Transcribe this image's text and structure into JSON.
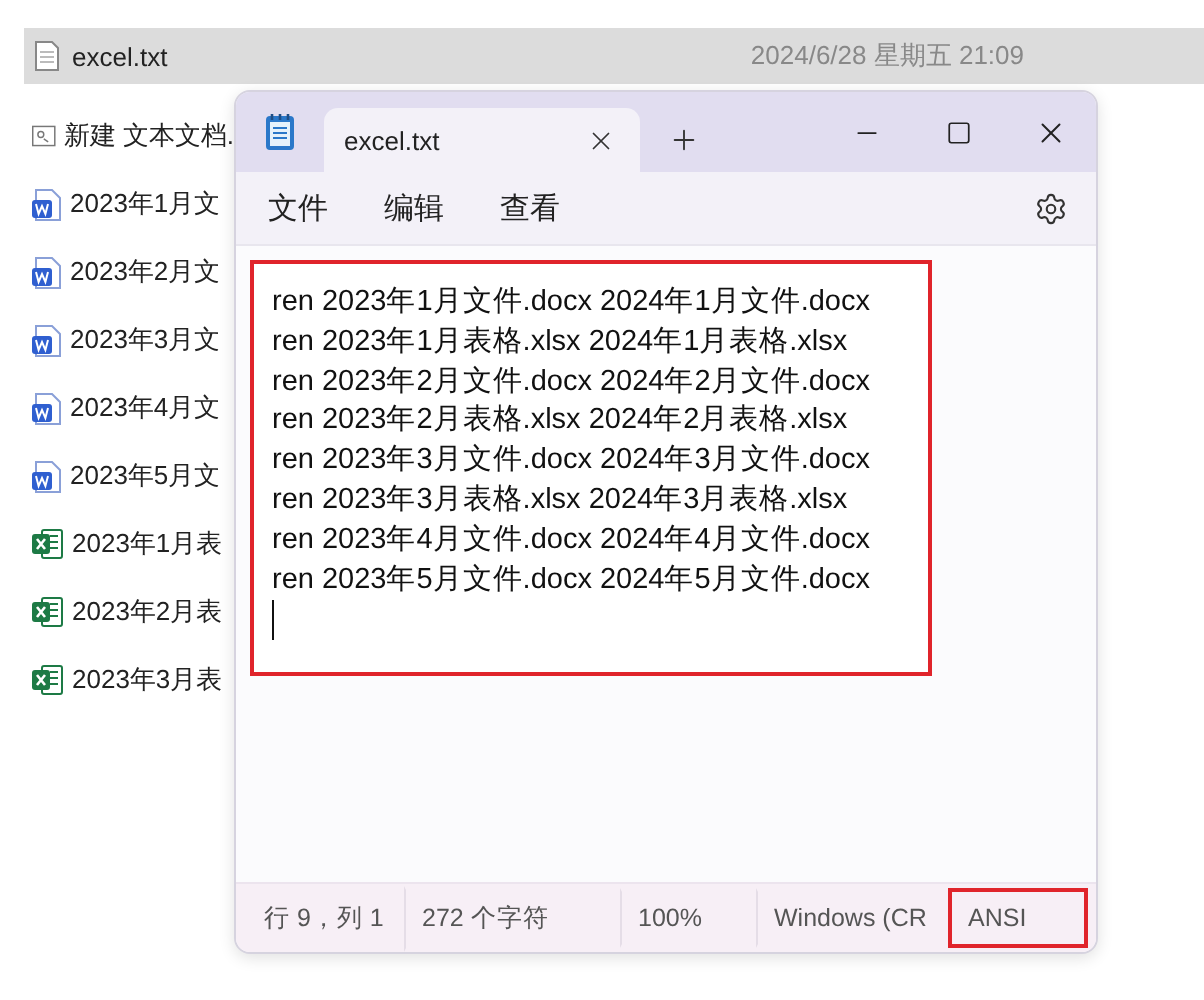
{
  "file_list": {
    "items": [
      {
        "name": "excel.txt",
        "date": "2024/6/28 星期五 21:09",
        "kind": "text",
        "selected": true
      },
      {
        "name": "新建 文本文档.",
        "kind": "shortcut",
        "selected": false
      },
      {
        "name": "2023年1月文",
        "kind": "word",
        "selected": false
      },
      {
        "name": "2023年2月文",
        "kind": "word",
        "selected": false
      },
      {
        "name": "2023年3月文",
        "kind": "word",
        "selected": false
      },
      {
        "name": "2023年4月文",
        "kind": "word",
        "selected": false
      },
      {
        "name": "2023年5月文",
        "kind": "word",
        "selected": false
      },
      {
        "name": "2023年1月表",
        "kind": "excel",
        "selected": false
      },
      {
        "name": "2023年2月表",
        "kind": "excel",
        "selected": false
      },
      {
        "name": "2023年3月表",
        "kind": "excel",
        "selected": false
      }
    ]
  },
  "notepad": {
    "tabs": [
      {
        "title": "excel.txt",
        "selected": true
      }
    ],
    "menu": [
      "文件",
      "编辑",
      "查看"
    ],
    "editor": {
      "highlighted": true,
      "lines": [
        "ren 2023年1月文件.docx 2024年1月文件.docx",
        "ren 2023年1月表格.xlsx 2024年1月表格.xlsx",
        "ren 2023年2月文件.docx 2024年2月文件.docx",
        "ren 2023年2月表格.xlsx 2024年2月表格.xlsx",
        "ren 2023年3月文件.docx 2024年3月文件.docx",
        "ren 2023年3月表格.xlsx 2024年3月表格.xlsx",
        "ren 2023年4月文件.docx 2024年4月文件.docx",
        "ren 2023年5月文件.docx 2024年5月文件.docx"
      ]
    },
    "status_bar": [
      {
        "text": "行 9，列 1",
        "highlighted": false
      },
      {
        "text": "272 个字符",
        "highlighted": false
      },
      {
        "text": "100%",
        "highlighted": false
      },
      {
        "text": "Windows (CR",
        "highlighted": false
      },
      {
        "text": "ANSI",
        "highlighted": true
      }
    ]
  }
}
